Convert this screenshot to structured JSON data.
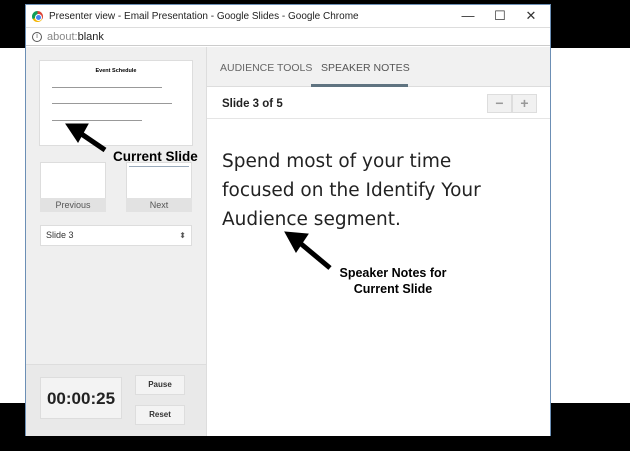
{
  "window": {
    "title": "Presenter view - Email Presentation - Google Slides - Google Chrome",
    "url_prefix": "about:",
    "url_main": "blank",
    "minimize": "—",
    "maximize": "☐",
    "close": "✕"
  },
  "left": {
    "current_slide_title": "Event Schedule",
    "previous_label": "Previous",
    "next_label": "Next",
    "slide_select": "Slide 3",
    "select_arrow": "⬍",
    "timer": "00:00:25",
    "pause": "Pause",
    "reset": "Reset"
  },
  "tabs": [
    {
      "label": "AUDIENCE TOOLS"
    },
    {
      "label": "SPEAKER NOTES",
      "active": true
    }
  ],
  "header": {
    "slide_counter": "Slide 3 of 5",
    "zoom_out": "−",
    "zoom_in": "+"
  },
  "notes": "Spend most of your time focused on the Identify Your Audience segment.",
  "annotations": {
    "current_slide": "Current Slide",
    "speaker_notes": "Speaker Notes for Current Slide"
  }
}
